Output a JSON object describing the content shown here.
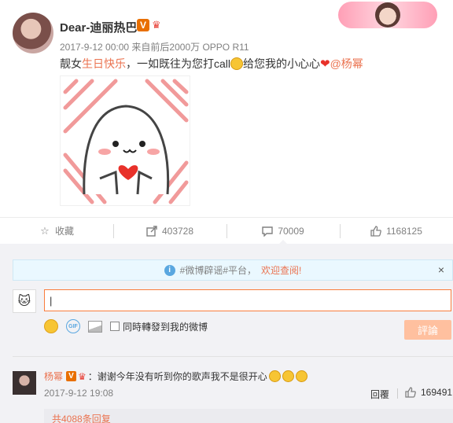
{
  "post": {
    "user_name": "Dear-迪丽热巴",
    "verified_badge": "V",
    "timestamp": "2017-9-12 00:00",
    "source": "来自前后2000万 OPPO R11",
    "text_prefix": "靓女",
    "text_highlight": "生日快乐",
    "text_middle": "，一如既往为您打call",
    "text_after_emoji": "给您我的小心心",
    "mention": "@杨幂",
    "image_alt": "dumpling character holding a heart"
  },
  "actions": {
    "favorite_label": "收藏",
    "repost_count": "403728",
    "comment_count": "70009",
    "like_count": "1168125"
  },
  "comments": {
    "notice_text": "#微博辟谣#平台，",
    "notice_link": "欢迎查阅!",
    "notice_close": "×",
    "input_value": "|",
    "repost_label": "同時轉發到我的微博",
    "submit_label": "評論",
    "items": [
      {
        "user": "杨幂",
        "verified": "V",
        "text": "：谢谢今年没有听到你的歌声我不是很开心",
        "time": "2017-9-12 19:08",
        "reply_label": "回覆",
        "likes": "169491"
      }
    ],
    "more_replies": "共4088条回复"
  },
  "icons": {
    "favorite": "star-icon",
    "repost": "repost-icon",
    "comment": "comment-icon",
    "like": "thumbs-up-icon",
    "info": "info-icon",
    "emoji": "smile-icon",
    "gif": "gif-icon",
    "picture": "picture-icon"
  },
  "colors": {
    "accent": "#eb7350",
    "input_border": "#fa7d3c",
    "submit_disabled": "#ffc09f",
    "panel_bg": "#f2f2f5"
  }
}
